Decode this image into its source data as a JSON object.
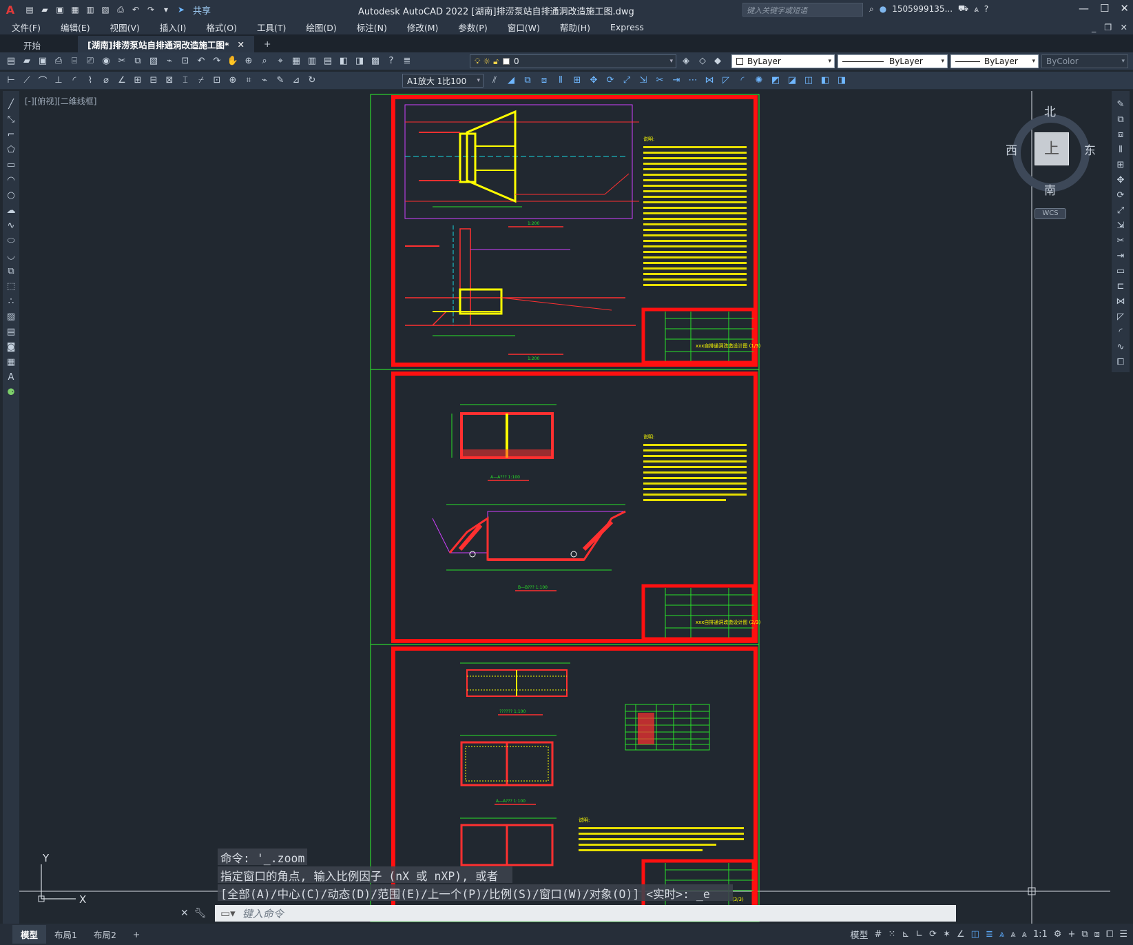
{
  "titlebar": {
    "app_title": "Autodesk AutoCAD 2022    [湖南]排涝泵站自排通洞改造施工图.dwg",
    "share_label": "共享",
    "search_placeholder": "键入关键字或短语",
    "user": "1505999135...",
    "logo": "A"
  },
  "menu": [
    "文件(F)",
    "编辑(E)",
    "视图(V)",
    "插入(I)",
    "格式(O)",
    "工具(T)",
    "绘图(D)",
    "标注(N)",
    "修改(M)",
    "参数(P)",
    "窗口(W)",
    "帮助(H)",
    "Express"
  ],
  "tabs": {
    "start": "开始",
    "active": "[湖南]排涝泵站自排通洞改造施工图*",
    "close": "✕",
    "add": "+"
  },
  "properties": {
    "layer": "0",
    "color": "ByLayer",
    "linetype": "ByLayer",
    "lineweight": "ByLayer",
    "plotstyle": "ByColor",
    "annoscale": "A1放大 1比100"
  },
  "viewport_label": "[-][俯视][二维线框]",
  "viewcube": {
    "north": "北",
    "south": "南",
    "east": "东",
    "west": "西",
    "top": "上",
    "wcs": "WCS"
  },
  "ucs": {
    "x": "X",
    "y": "Y"
  },
  "command": {
    "history": [
      "命令: '_.zoom",
      "指定窗口的角点, 输入比例因子 (nX 或 nXP), 或者",
      "[全部(A)/中心(C)/动态(D)/范围(E)/上一个(P)/比例(S)/窗口(W)/对象(O)] <实时>: _e"
    ],
    "placeholder": "键入命令"
  },
  "layout_tabs": [
    "模型",
    "布局1",
    "布局2",
    "+"
  ],
  "status": {
    "model": "模型",
    "scale": "1:1"
  },
  "sheets": [
    {
      "notes_title": "说明:",
      "title_block": "xxx自排通洞改造设计图 (1/3)",
      "scale_labels": [
        "1:200",
        "1:200"
      ]
    },
    {
      "notes_title": "说明:",
      "title_block": "xxx自排通洞改造设计图 (2/3)",
      "scale_labels": [
        "A—A??? 1:100",
        "B—B??? 1:100"
      ]
    },
    {
      "notes_title": "说明:",
      "title_block": "(3/3)",
      "scale_labels": [
        "?????? 1:100",
        "A—A??? 1:100"
      ]
    }
  ],
  "colors": {
    "frame": "#ff1010",
    "outer": "#2ed52e",
    "dim": "#29e229",
    "text": "#ffff00",
    "lines": "#ff3030",
    "magenta": "#d040ff",
    "cyan": "#18d8e0",
    "background": "#212830"
  }
}
